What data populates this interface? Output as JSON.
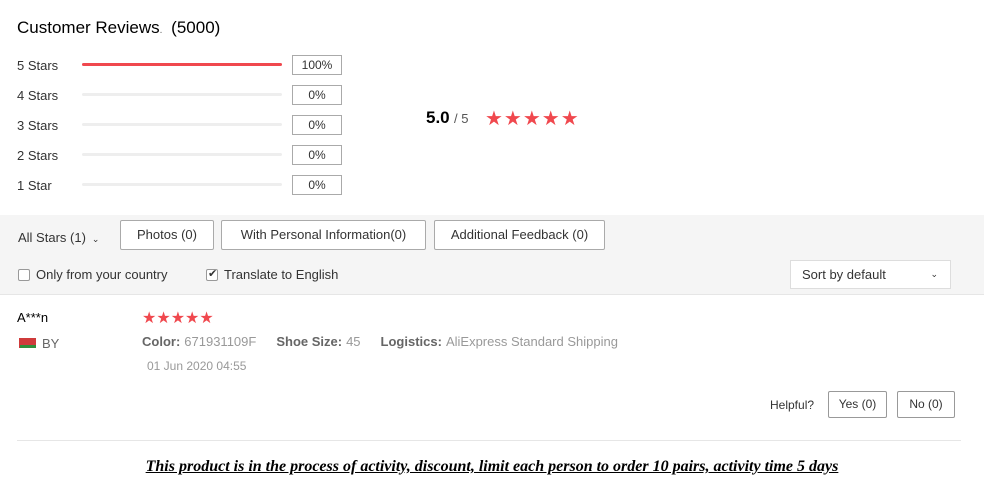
{
  "header": {
    "title": "Customer Reviews",
    "dot": ".",
    "count": "(5000)"
  },
  "distribution": [
    {
      "label": "5 Stars",
      "percent": "100%",
      "fraction": 1.0
    },
    {
      "label": "4 Stars",
      "percent": "0%",
      "fraction": 0.0
    },
    {
      "label": "3 Stars",
      "percent": "0%",
      "fraction": 0.0
    },
    {
      "label": "2 Stars",
      "percent": "0%",
      "fraction": 0.0
    },
    {
      "label": "1 Star",
      "percent": "0%",
      "fraction": 0.0
    }
  ],
  "summary": {
    "average": "5.0",
    "max": "/ 5",
    "stars": "★★★★★",
    "rating": 5
  },
  "filters": {
    "all_stars": "All Stars (1)",
    "photos": "Photos (0)",
    "personal": "With Personal Information(0)",
    "additional": "Additional Feedback (0)",
    "only_country": "Only from your country",
    "only_country_checked": false,
    "translate": "Translate to English",
    "translate_checked": true,
    "sort": "Sort by default"
  },
  "review": {
    "name": "A***n",
    "country": "BY",
    "stars": "★★★★★",
    "rating": 5,
    "color_label": "Color:",
    "color_value": "671931109F",
    "size_label": "Shoe Size:",
    "size_value": "45",
    "logistics_label": "Logistics:",
    "logistics_value": "AliExpress Standard Shipping",
    "date": "01 Jun 2020 04:55",
    "helpful_label": "Helpful?",
    "yes": "Yes (0)",
    "no": "No (0)"
  },
  "notice": "This product is in the process of activity, discount, limit each person to order 10 pairs, activity time 5 days",
  "colors": {
    "accent": "#f0484e",
    "filter_bg": "#f5f5f5"
  },
  "icons": {
    "dropdown": "chevron-down-icon",
    "check": "check-icon",
    "flag": "belarus-flag-icon",
    "star": "star-icon"
  }
}
